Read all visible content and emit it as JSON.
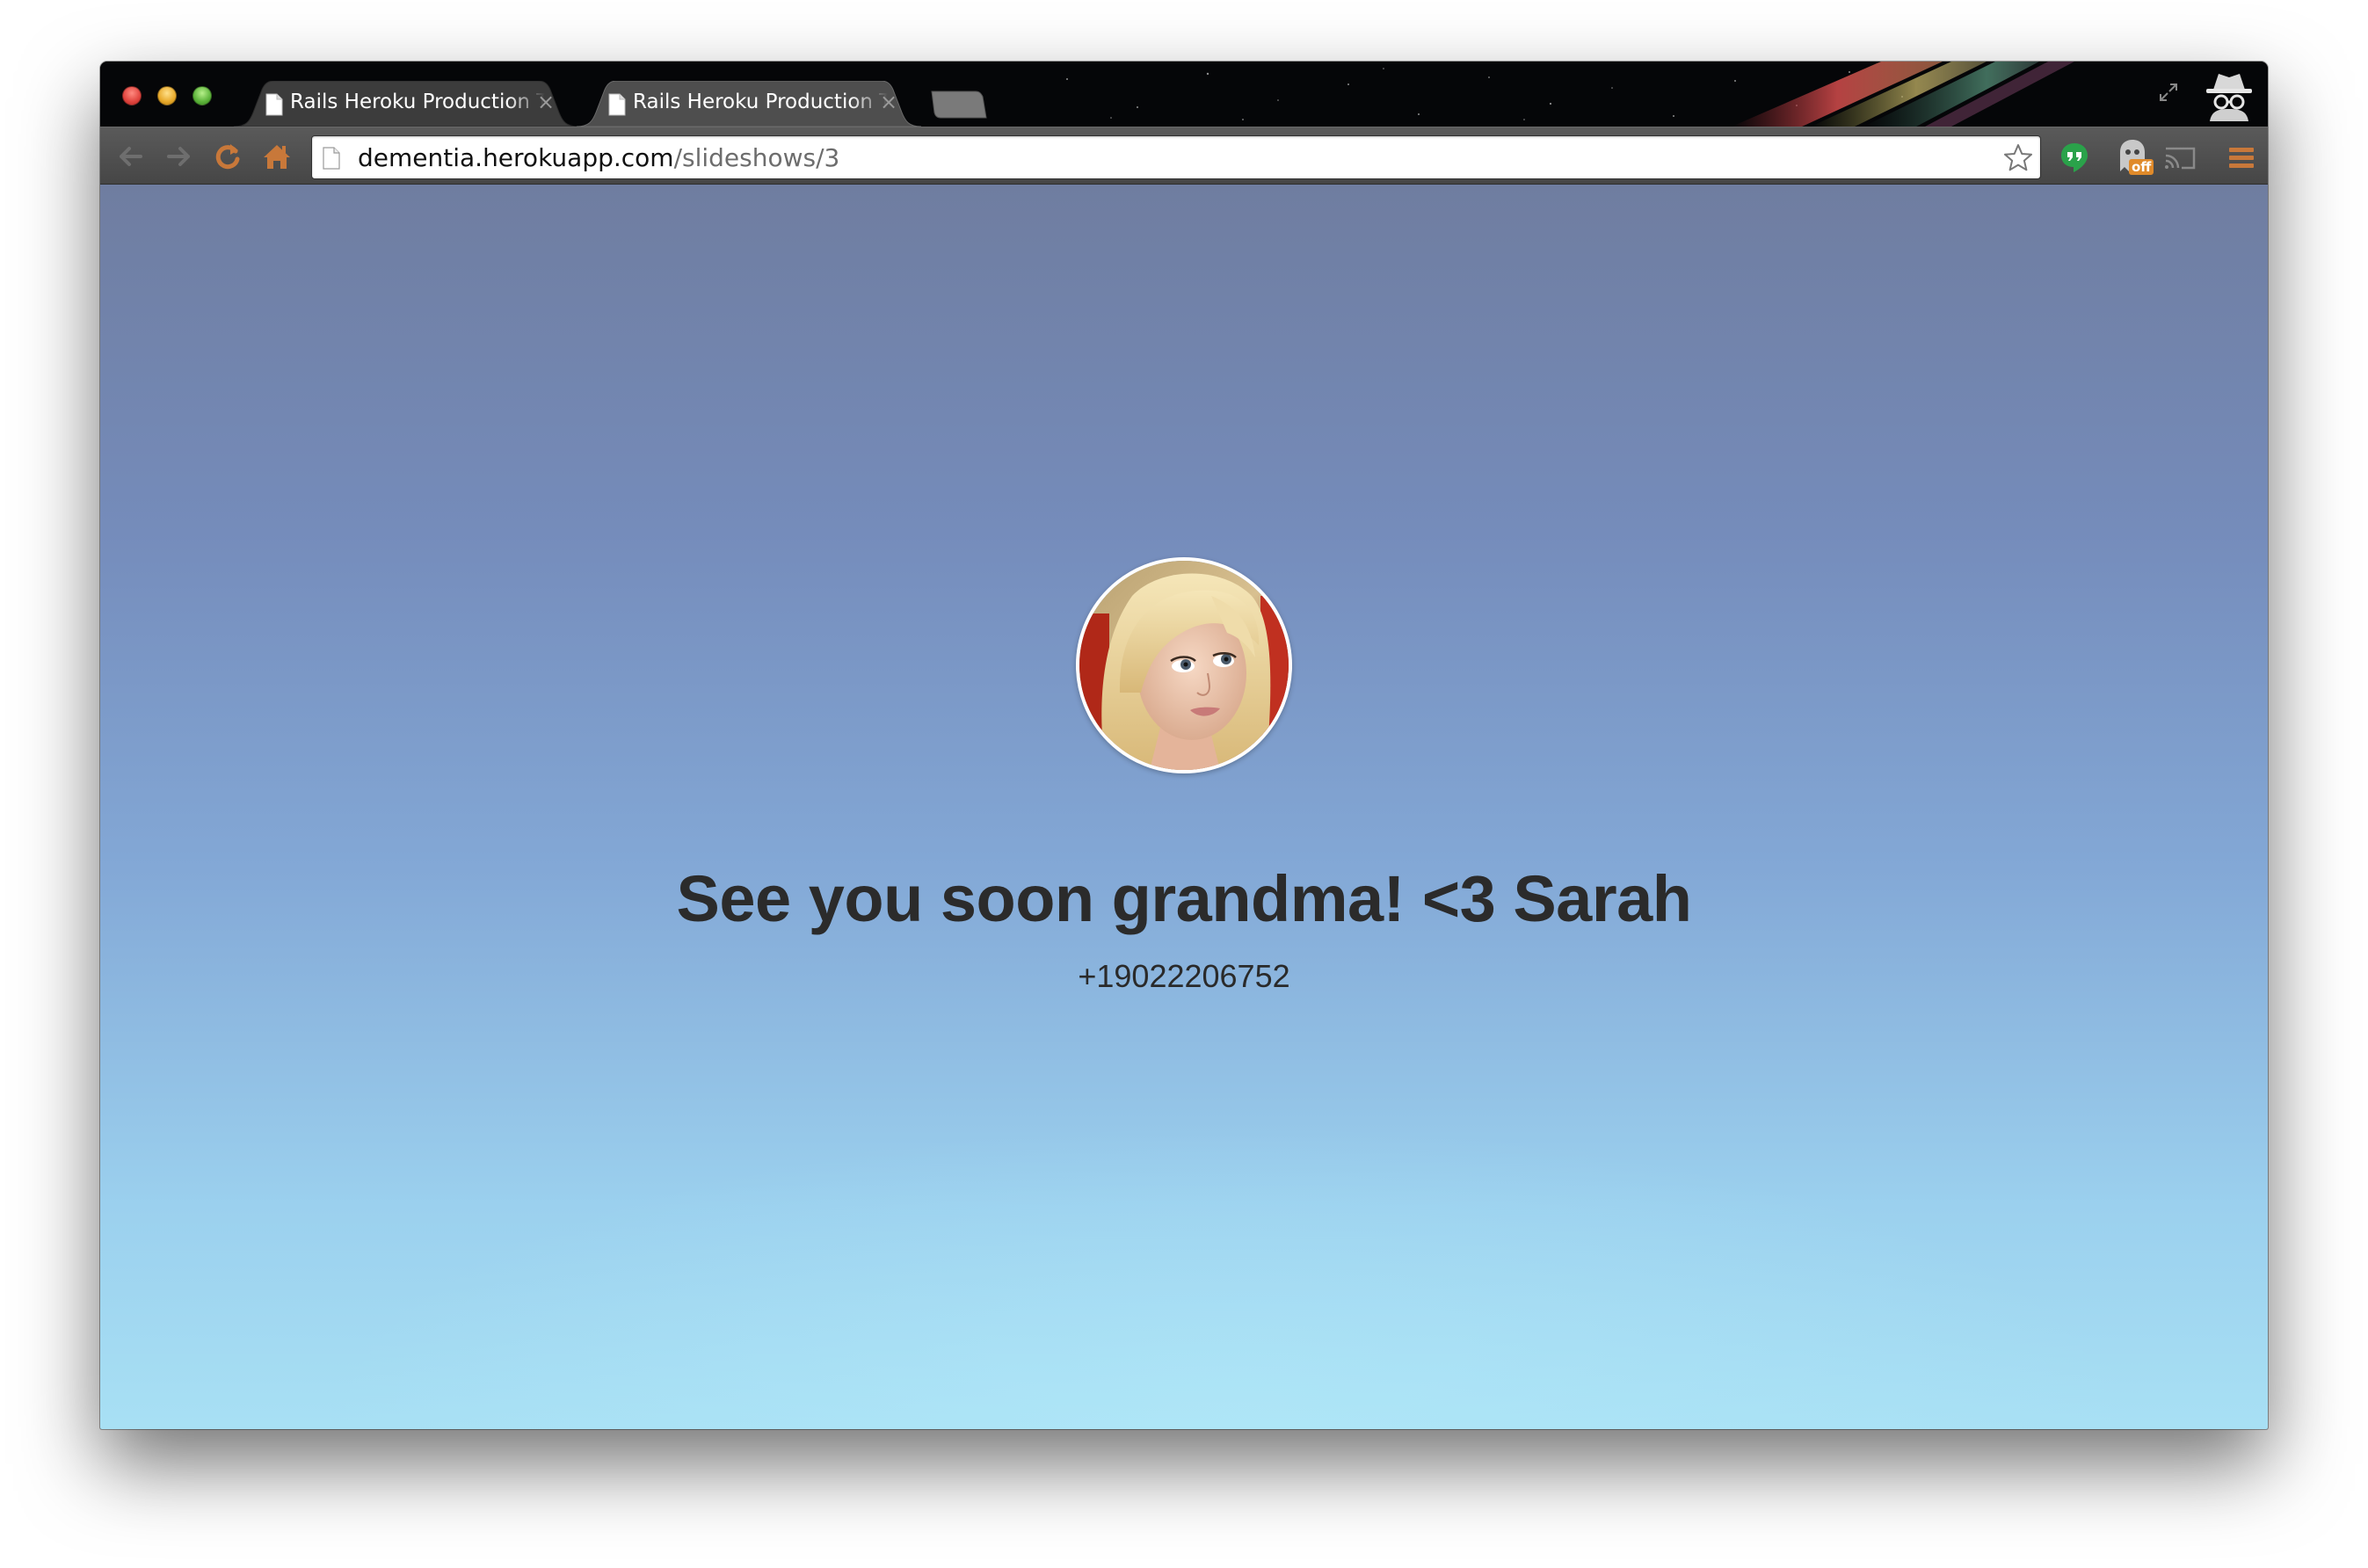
{
  "browser": {
    "tabs": [
      {
        "title": "Rails Heroku Production Template",
        "active": false
      },
      {
        "title": "Rails Heroku Production Template",
        "active": true
      }
    ],
    "omnibox": {
      "url_host": "dementia.herokuapp.com",
      "url_path": "/slideshows/3"
    },
    "extensions": {
      "ghost_badge": "off"
    },
    "icons": [
      "back-arrow-icon",
      "forward-arrow-icon",
      "reload-icon",
      "home-icon",
      "page-icon",
      "star-icon",
      "hangouts-icon",
      "ghostery-icon",
      "cast-icon",
      "menu-icon",
      "incognito-icon"
    ],
    "colors": {
      "toolbar_icon": "#c8783a",
      "hangouts": "#2aa24a"
    }
  },
  "page": {
    "message": "See you soon grandma! <3 Sarah",
    "phone": "+19022206752"
  }
}
